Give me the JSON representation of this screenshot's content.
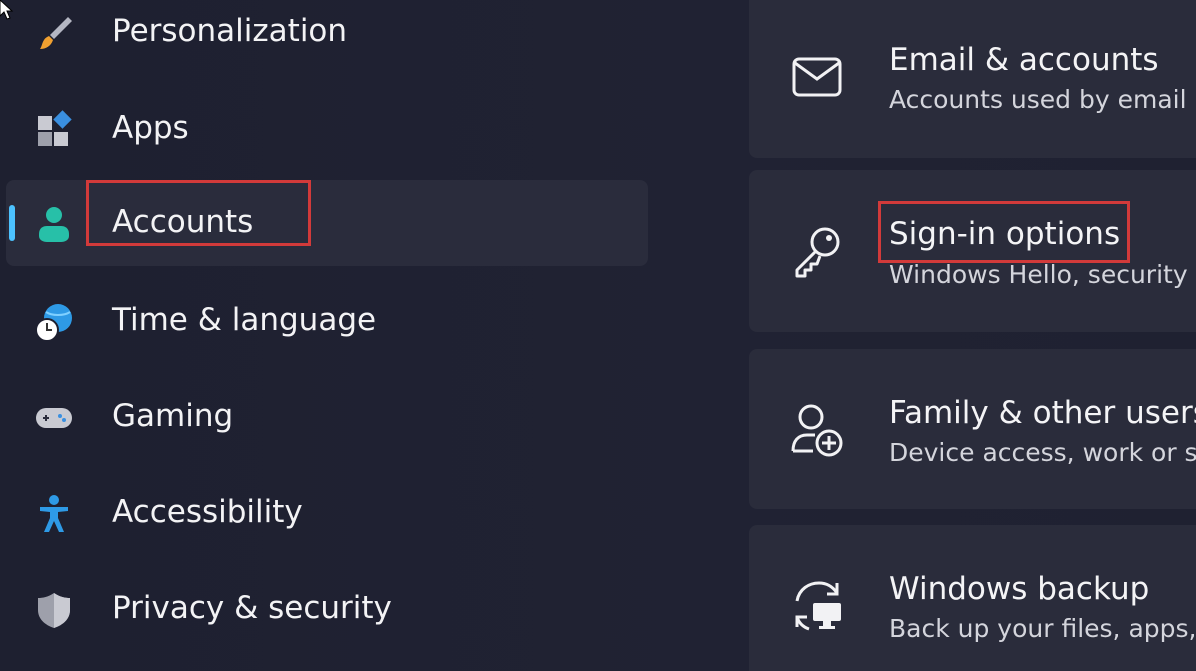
{
  "sidebar": {
    "items": [
      {
        "label": "Personalization",
        "icon": "paintbrush-icon",
        "selected": false
      },
      {
        "label": "Apps",
        "icon": "apps-icon",
        "selected": false
      },
      {
        "label": "Accounts",
        "icon": "person-icon",
        "selected": true
      },
      {
        "label": "Time & language",
        "icon": "globe-clock-icon",
        "selected": false
      },
      {
        "label": "Gaming",
        "icon": "gamepad-icon",
        "selected": false
      },
      {
        "label": "Accessibility",
        "icon": "accessibility-icon",
        "selected": false
      },
      {
        "label": "Privacy & security",
        "icon": "shield-icon",
        "selected": false
      }
    ]
  },
  "cards": [
    {
      "title": "Email & accounts",
      "description": "Accounts used by email",
      "icon": "mail-icon"
    },
    {
      "title": "Sign-in options",
      "description": "Windows Hello, security",
      "icon": "key-icon"
    },
    {
      "title": "Family & other users",
      "description": "Device access, work or s",
      "icon": "person-add-icon"
    },
    {
      "title": "Windows backup",
      "description": "Back up your files, apps,",
      "icon": "sync-pc-icon"
    }
  ],
  "colors": {
    "background": "#202232",
    "selected_item": "#2a2c3c",
    "card": "#2a2c3b",
    "accent": "#4cc2ff",
    "highlight_box": "#d23a3a"
  }
}
